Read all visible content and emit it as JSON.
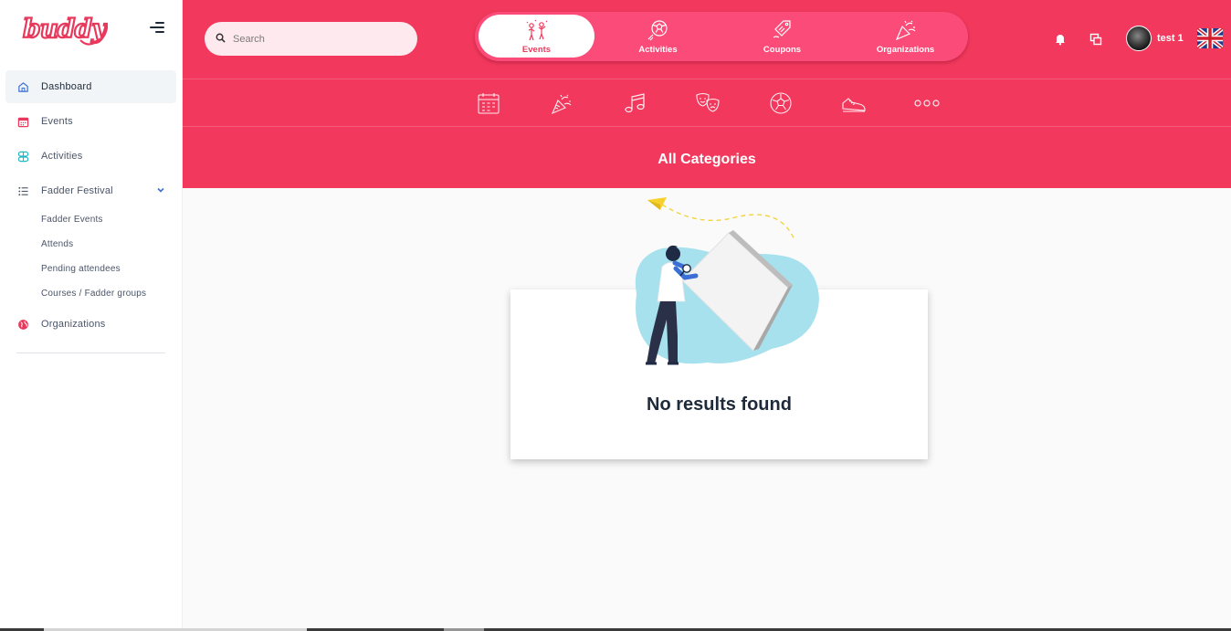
{
  "brand": {
    "name": "buddy",
    "color": "#e8395d"
  },
  "colors": {
    "accent": "#f2395d",
    "tab_bg": "#fb4b78"
  },
  "search": {
    "placeholder": "Search"
  },
  "sidebar": {
    "items": [
      {
        "label": "Dashboard",
        "icon": "home-icon"
      },
      {
        "label": "Events",
        "icon": "calendar-icon"
      },
      {
        "label": "Activities",
        "icon": "activities-icon"
      },
      {
        "label": "Fadder Festival",
        "icon": "list-icon"
      },
      {
        "label": "Organizations",
        "icon": "globe-icon"
      }
    ],
    "subitems": [
      {
        "label": "Fadder Events"
      },
      {
        "label": "Attends"
      },
      {
        "label": "Pending attendees"
      },
      {
        "label": "Courses / Fadder groups"
      }
    ]
  },
  "tabs": [
    {
      "label": "Events",
      "icon": "party-people-icon",
      "active": true
    },
    {
      "label": "Activities",
      "icon": "soccer-ball-icon",
      "active": false
    },
    {
      "label": "Coupons",
      "icon": "coupon-tag-icon",
      "active": false
    },
    {
      "label": "Organizations",
      "icon": "party-popper-icon",
      "active": false
    }
  ],
  "categories": [
    {
      "icon": "calendar-icon"
    },
    {
      "icon": "party-popper-icon"
    },
    {
      "icon": "music-note-icon"
    },
    {
      "icon": "theater-masks-icon"
    },
    {
      "icon": "soccer-ball-icon"
    },
    {
      "icon": "sneaker-icon"
    },
    {
      "icon": "more-icon"
    }
  ],
  "category_title": "All Categories",
  "user": {
    "name": "test 1"
  },
  "language": {
    "flag": "uk-flag-icon"
  },
  "empty_state": {
    "message": "No results found"
  }
}
